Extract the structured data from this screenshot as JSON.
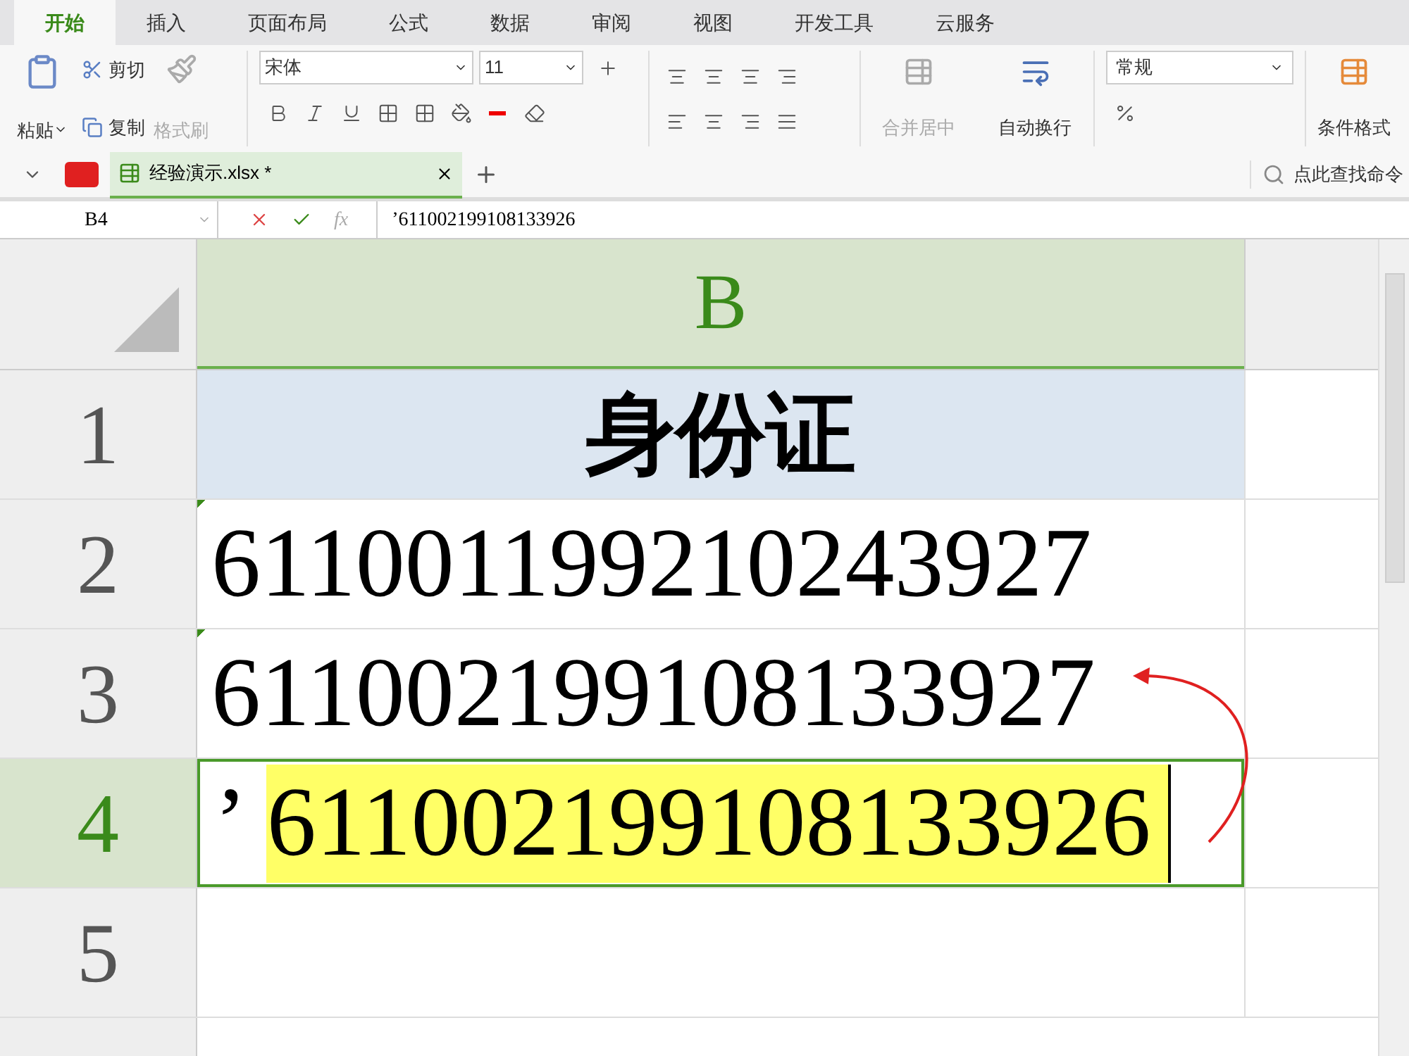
{
  "tabs": [
    {
      "label": "开始",
      "selected": true
    },
    {
      "label": "插入",
      "selected": false
    },
    {
      "label": "页面布局",
      "selected": false
    },
    {
      "label": "公式",
      "selected": false
    },
    {
      "label": "数据",
      "selected": false
    },
    {
      "label": "审阅",
      "selected": false
    },
    {
      "label": "视图",
      "selected": false
    },
    {
      "label": "开发工具",
      "selected": false
    },
    {
      "label": "云服务",
      "selected": false
    }
  ],
  "clipboard": {
    "paste": "粘贴",
    "cut": "剪切",
    "copy": "复制",
    "format_painter": {
      "label": "格式刷",
      "disabled": true
    }
  },
  "font": {
    "name": "宋体",
    "size": "11"
  },
  "alignment": {
    "merge": {
      "label": "合并居中",
      "disabled": true
    },
    "wrap": {
      "label": "自动换行",
      "disabled": false
    }
  },
  "number": {
    "format": "常规"
  },
  "styles": {
    "conditional_format": "条件格式"
  },
  "document_tabs": [
    {
      "title": "经验演示.xlsx *",
      "selected": true
    }
  ],
  "command_search": {
    "placeholder": "点此查找命令"
  },
  "formula_bar": {
    "cell_ref": "B4",
    "fx": "fx",
    "value": "’611002199108133926"
  },
  "sheet": {
    "column": "B",
    "rows": [
      {
        "header": "1",
        "kind": "title",
        "text": "身份证",
        "selected": false,
        "flag": false
      },
      {
        "header": "2",
        "kind": "entry",
        "text": "611001199210243927",
        "selected": false,
        "flag": true,
        "highlighted": false
      },
      {
        "header": "3",
        "kind": "entry",
        "text": "611002199108133927",
        "selected": false,
        "flag": true,
        "highlighted": false
      },
      {
        "header": "4",
        "kind": "entry",
        "prefix": "’",
        "text": "611002199108133926",
        "selected": true,
        "flag": false,
        "highlighted": true
      },
      {
        "header": "5",
        "kind": "empty",
        "selected": false
      }
    ]
  }
}
